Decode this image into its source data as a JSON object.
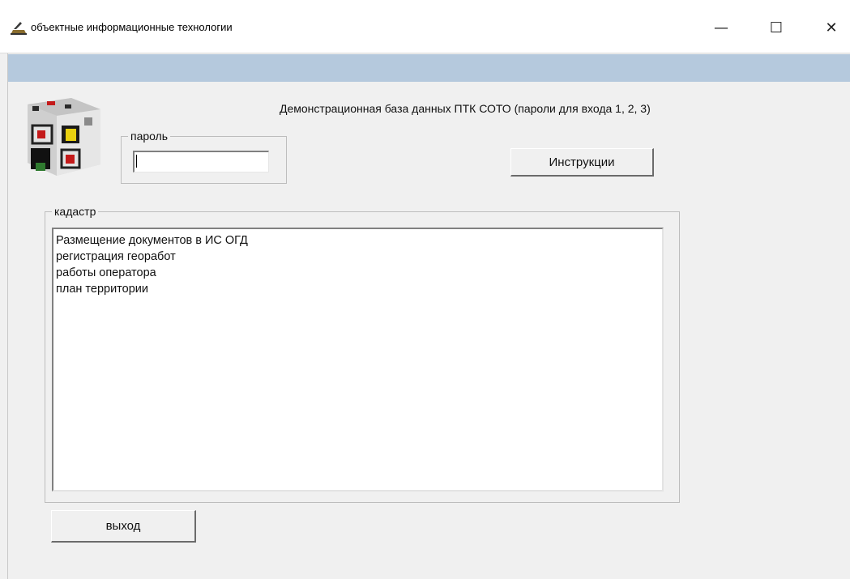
{
  "window": {
    "title": "объектные информационные технологии",
    "minimize_glyph": "—",
    "maximize_glyph": "☐",
    "close_glyph": "✕"
  },
  "header": {
    "text": "Демонстрационная база данных ПТК СОТО (пароли для входа 1, 2, 3)"
  },
  "password": {
    "label": "пароль",
    "value": ""
  },
  "instructions_button": {
    "label": "Инструкции"
  },
  "cadastre": {
    "label": "кадастр",
    "items": [
      "Размещение документов в ИС ОГД",
      "регистрация георабот",
      "работы оператора",
      "план территории"
    ]
  },
  "exit_button": {
    "label": "выход"
  },
  "colors": {
    "menu_strip": "#b5c9dd",
    "background": "#f0f0f0"
  },
  "icons": {
    "app": "app-logo-icon",
    "logo": "soto-cube-logo"
  }
}
